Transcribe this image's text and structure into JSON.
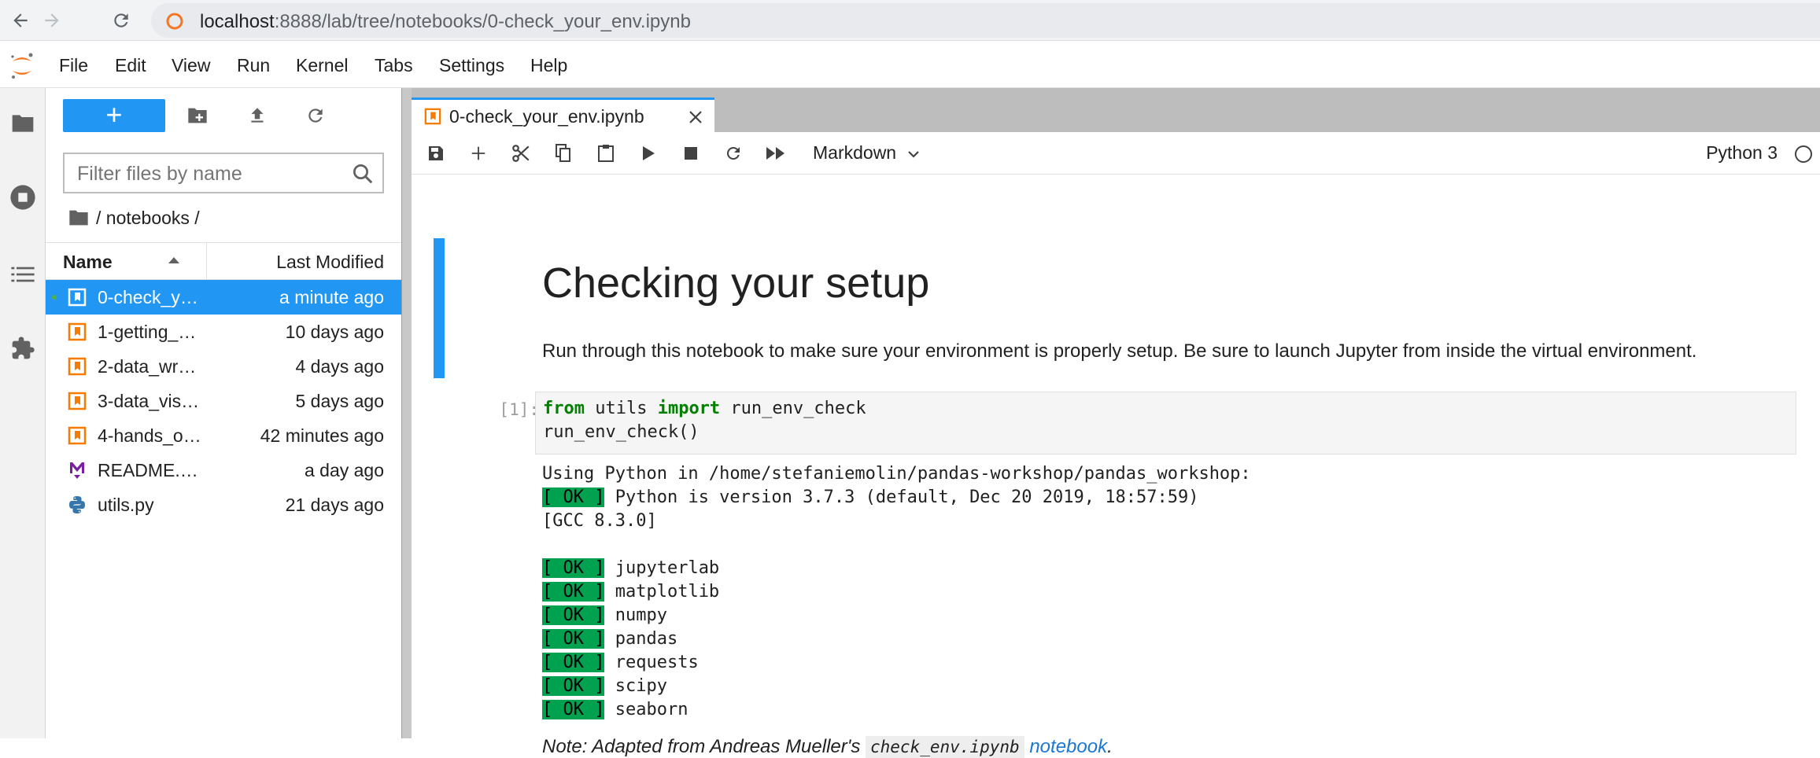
{
  "browser": {
    "url_host": "localhost",
    "url_path": ":8888/lab/tree/notebooks/0-check_your_env.ipynb"
  },
  "menubar": {
    "items": [
      "File",
      "Edit",
      "View",
      "Run",
      "Kernel",
      "Tabs",
      "Settings",
      "Help"
    ]
  },
  "file_browser": {
    "new_button_label": "+",
    "filter_placeholder": "Filter files by name",
    "breadcrumb": "/ notebooks /",
    "col_name": "Name",
    "col_modified": "Last Modified",
    "files": [
      {
        "name": "0-check_y…",
        "modified": "a minute ago",
        "icon": "notebook-icon",
        "selected": true,
        "running": true
      },
      {
        "name": "1-getting_…",
        "modified": "10 days ago",
        "icon": "notebook-icon"
      },
      {
        "name": "2-data_wr…",
        "modified": "4 days ago",
        "icon": "notebook-icon"
      },
      {
        "name": "3-data_vis…",
        "modified": "5 days ago",
        "icon": "notebook-icon"
      },
      {
        "name": "4-hands_o…",
        "modified": "42 minutes ago",
        "icon": "notebook-icon"
      },
      {
        "name": "README.…",
        "modified": "a day ago",
        "icon": "markdown-icon"
      },
      {
        "name": "utils.py",
        "modified": "21 days ago",
        "icon": "python-icon"
      }
    ]
  },
  "notebook": {
    "tab_title": "0-check_your_env.ipynb",
    "cell_type": "Markdown",
    "kernel_name": "Python 3",
    "heading": "Checking your setup",
    "paragraph": "Run through this notebook to make sure your environment is properly setup. Be sure to launch Jupyter from inside the virtual environment.",
    "input_prompt": "[1]:",
    "code": {
      "kw_from": "from",
      "module": " utils ",
      "kw_import": "import",
      "name": " run_env_check",
      "line2": "run_env_check()"
    },
    "output": {
      "line1": "Using Python in /home/stefaniemolin/pandas-workshop/pandas_workshop:",
      "ok_label": "[ OK ]",
      "python_version": " Python is version 3.7.3 (default, Dec 20 2019, 18:57:59)",
      "gcc": "[GCC 8.3.0]",
      "packages": [
        " jupyterlab",
        " matplotlib",
        " numpy",
        " pandas",
        " requests",
        " scipy",
        " seaborn"
      ]
    },
    "note": {
      "prefix": "Note: Adapted from Andreas Mueller's ",
      "code": "check_env.ipynb",
      "link": "notebook",
      "suffix": "."
    }
  },
  "colors": {
    "accent": "#2196f3",
    "ok_green": "#00a250",
    "notebook_orange": "#f57c00",
    "markdown_purple": "#7b1fa2",
    "keyword_green": "#008000"
  }
}
